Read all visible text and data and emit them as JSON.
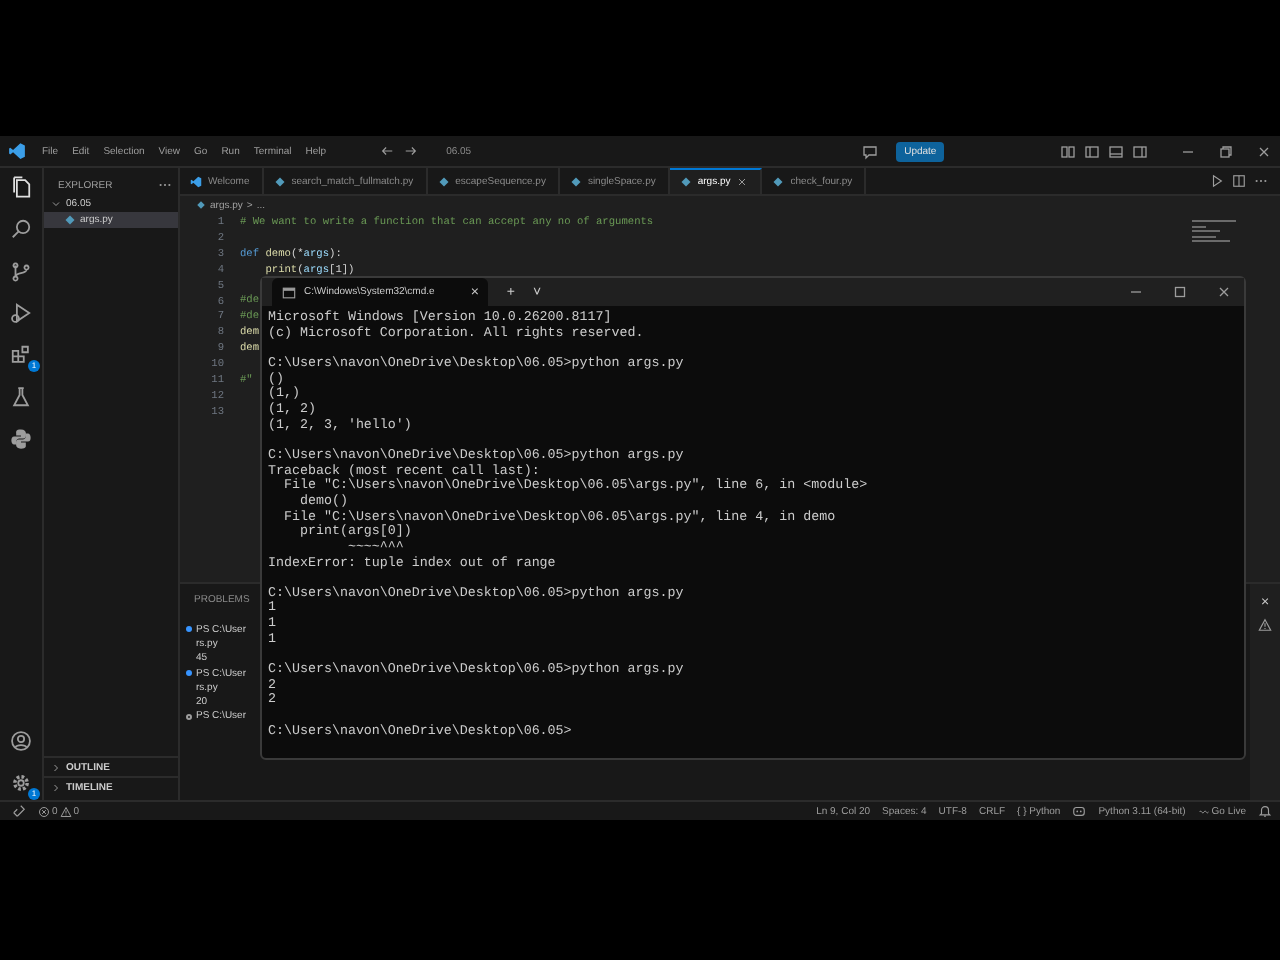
{
  "titlebar": {
    "menu": [
      "File",
      "Edit",
      "Selection",
      "View",
      "Go",
      "Run",
      "Terminal",
      "Help"
    ],
    "search": "06.05",
    "update_button": "Update"
  },
  "activity_bar": {
    "extensions_badge": "1",
    "settings_badge": "1"
  },
  "explorer": {
    "title": "EXPLORER",
    "folder": {
      "label": "06.05",
      "expanded": true,
      "children": [
        {
          "label": "args.py",
          "selected": true
        }
      ]
    },
    "sections": [
      {
        "label": "OUTLINE",
        "expanded": false
      },
      {
        "label": "TIMELINE",
        "expanded": false
      }
    ]
  },
  "tabs": [
    {
      "label": "Welcome",
      "kind": "welcome",
      "selected": false
    },
    {
      "label": "search_match_fullmatch.py",
      "kind": "python",
      "selected": false
    },
    {
      "label": "escapeSequence.py",
      "kind": "python",
      "selected": false
    },
    {
      "label": "singleSpace.py",
      "kind": "python",
      "selected": false
    },
    {
      "label": "args.py",
      "kind": "python",
      "selected": true
    },
    {
      "label": "check_four.py",
      "kind": "python",
      "selected": false
    }
  ],
  "breadcrumb": [
    "args.py",
    ">",
    "..."
  ],
  "editor": {
    "lines": [
      {
        "number": "1",
        "tokens": [
          {
            "kind": "comment",
            "text": "# We want to write a function that can accept any no of arguments"
          }
        ]
      },
      {
        "number": "2"
      },
      {
        "number": "3",
        "tokens": [
          {
            "kind": "keyword",
            "text": "def "
          },
          {
            "kind": "function",
            "text": "demo"
          },
          {
            "kind": "plain",
            "text": "(*"
          },
          {
            "kind": "param",
            "text": "args"
          },
          {
            "kind": "plain",
            "text": "):"
          }
        ]
      },
      {
        "number": "4",
        "tokens": [
          {
            "kind": "function",
            "text": "    print"
          },
          {
            "kind": "plain",
            "text": "("
          },
          {
            "kind": "param",
            "text": "args"
          },
          {
            "kind": "plain",
            "text": "[1])"
          }
        ]
      },
      {
        "number": "5"
      },
      {
        "number": "6",
        "tokens": [
          {
            "kind": "comment",
            "text": "#de"
          }
        ]
      },
      {
        "number": "7",
        "tokens": [
          {
            "kind": "comment",
            "text": "#de"
          }
        ]
      },
      {
        "number": "8",
        "tokens": [
          {
            "kind": "function",
            "text": "dem"
          }
        ]
      },
      {
        "number": "9",
        "tokens": [
          {
            "kind": "function",
            "text": "dem"
          }
        ]
      },
      {
        "number": "10"
      },
      {
        "number": "11",
        "tokens": [
          {
            "kind": "comment",
            "text": "#\""
          }
        ]
      },
      {
        "number": "12"
      },
      {
        "number": "13"
      }
    ]
  },
  "panel": {
    "tab": "PROBLEMS",
    "close": "×",
    "terminal_lines": [
      {
        "kind": "prompt-done",
        "text": "PS C:\\User"
      },
      {
        "kind": "output",
        "text": "rs.py"
      },
      {
        "kind": "output",
        "text": "45"
      },
      {
        "kind": "prompt-done",
        "text": "PS C:\\User"
      },
      {
        "kind": "output",
        "text": "rs.py"
      },
      {
        "kind": "output",
        "text": "20"
      },
      {
        "kind": "prompt-idle",
        "text": "PS C:\\User"
      }
    ]
  },
  "status_bar": {
    "errors": "0",
    "warnings": "0",
    "items": [
      "Ln 9, Col 20",
      "Spaces: 4",
      "UTF-8",
      "CRLF",
      "{ } Python",
      "Python 3.11 (64-bit)",
      "Go Live"
    ]
  },
  "cmd": {
    "tab_title": "C:\\Windows\\System32\\cmd.e",
    "tab_close": "×",
    "new_tab": "+",
    "dropdown": "˅",
    "blocks": [
      [
        "Microsoft Windows [Version 10.0.26200.8117]",
        "(c) Microsoft Corporation. All rights reserved."
      ],
      [
        "C:\\Users\\navon\\OneDrive\\Desktop\\06.05>python args.py",
        "()",
        "(1,)",
        "(1, 2)",
        "(1, 2, 3, 'hello')"
      ],
      [
        "C:\\Users\\navon\\OneDrive\\Desktop\\06.05>python args.py",
        "Traceback (most recent call last):",
        "  File \"C:\\Users\\navon\\OneDrive\\Desktop\\06.05\\args.py\", line 6, in <module>",
        "    demo()",
        "  File \"C:\\Users\\navon\\OneDrive\\Desktop\\06.05\\args.py\", line 4, in demo",
        "    print(args[0])",
        "          ~~~~^^^",
        "IndexError: tuple index out of range"
      ],
      [
        "C:\\Users\\navon\\OneDrive\\Desktop\\06.05>python args.py",
        "1",
        "1",
        "1"
      ],
      [
        "C:\\Users\\navon\\OneDrive\\Desktop\\06.05>python args.py",
        "2",
        "2"
      ],
      [
        "C:\\Users\\navon\\OneDrive\\Desktop\\06.05>"
      ]
    ]
  }
}
